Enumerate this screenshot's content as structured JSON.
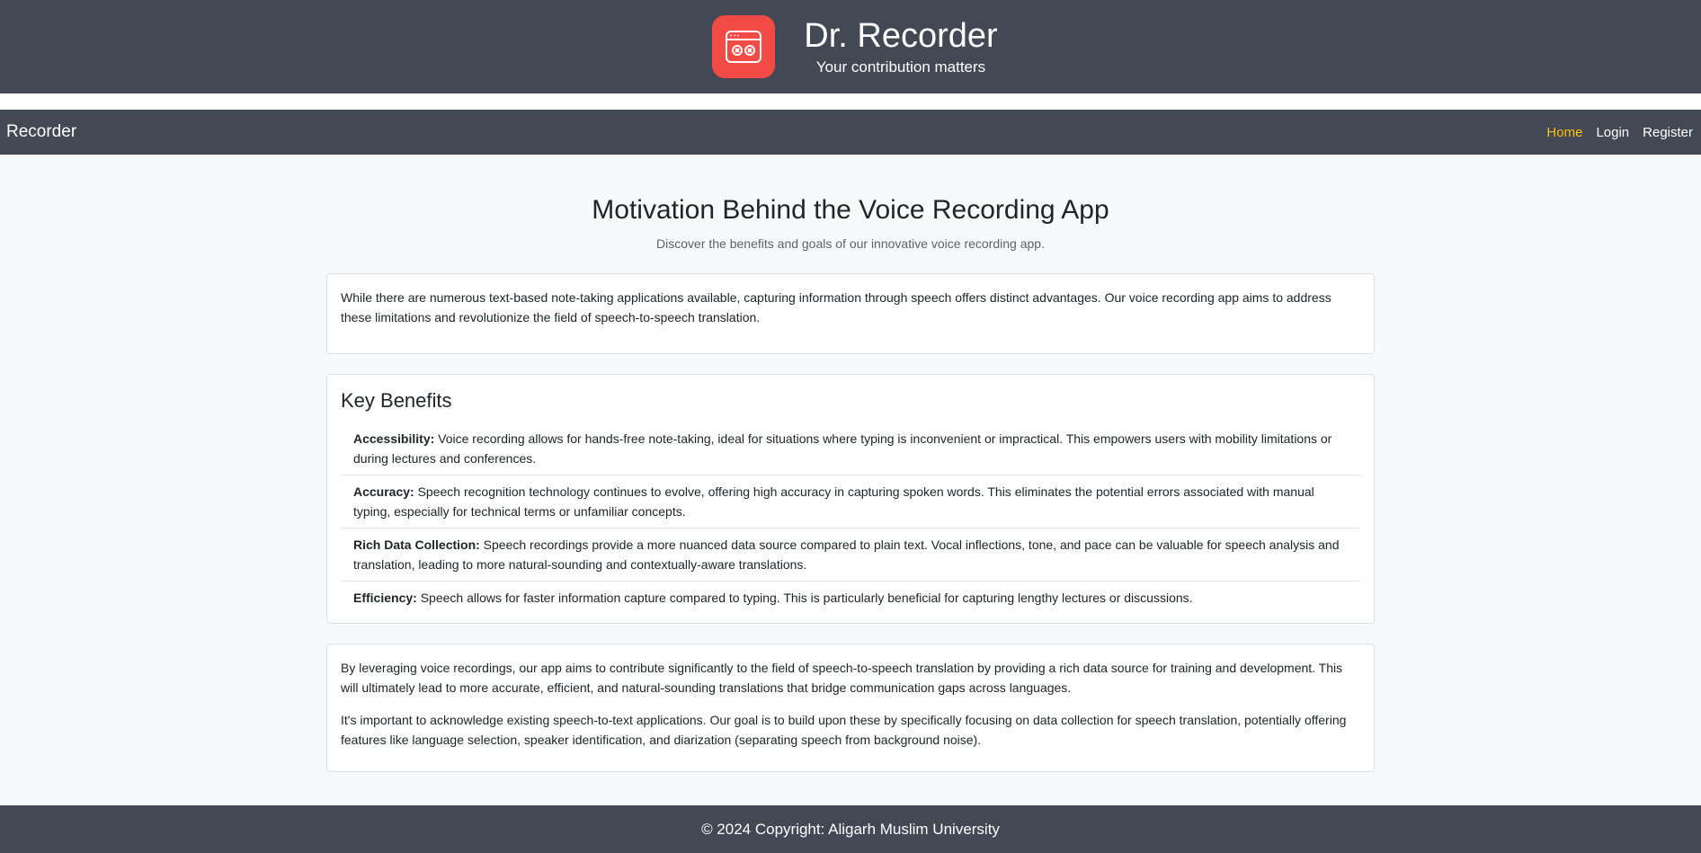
{
  "header": {
    "title": "Dr. Recorder",
    "subtitle": "Your contribution matters",
    "logo_icon": "recorder-window-icon",
    "logo_color": "#f24a45"
  },
  "navbar": {
    "brand": "Recorder",
    "links": [
      {
        "label": "Home",
        "active": true
      },
      {
        "label": "Login",
        "active": false
      },
      {
        "label": "Register",
        "active": false
      }
    ],
    "active_color": "#ffc107"
  },
  "main": {
    "title": "Motivation Behind the Voice Recording App",
    "lead": "Discover the benefits and goals of our innovative voice recording app.",
    "intro": "While there are numerous text-based note-taking applications available, capturing information through speech offers distinct advantages. Our voice recording app aims to address these limitations and revolutionize the field of speech-to-speech translation.",
    "benefits_title": "Key Benefits",
    "benefits": [
      {
        "term": "Accessibility:",
        "text": " Voice recording allows for hands-free note-taking, ideal for situations where typing is inconvenient or impractical. This empowers users with mobility limitations or during lectures and conferences."
      },
      {
        "term": "Accuracy:",
        "text": " Speech recognition technology continues to evolve, offering high accuracy in capturing spoken words. This eliminates the potential errors associated with manual typing, especially for technical terms or unfamiliar concepts."
      },
      {
        "term": "Rich Data Collection:",
        "text": " Speech recordings provide a more nuanced data source compared to plain text. Vocal inflections, tone, and pace can be valuable for speech analysis and translation, leading to more natural-sounding and contextually-aware translations."
      },
      {
        "term": "Efficiency:",
        "text": " Speech allows for faster information capture compared to typing. This is particularly beneficial for capturing lengthy lectures or discussions."
      }
    ],
    "closing_1": "By leveraging voice recordings, our app aims to contribute significantly to the field of speech-to-speech translation by providing a rich data source for training and development. This will ultimately lead to more accurate, efficient, and natural-sounding translations that bridge communication gaps across languages.",
    "closing_2": "It's important to acknowledge existing speech-to-text applications. Our goal is to build upon these by specifically focusing on data collection for speech translation, potentially offering features like language selection, speaker identification, and diarization (separating speech from background noise)."
  },
  "footer": {
    "copyright": "© 2024 Copyright: Aligarh Muslim University"
  }
}
